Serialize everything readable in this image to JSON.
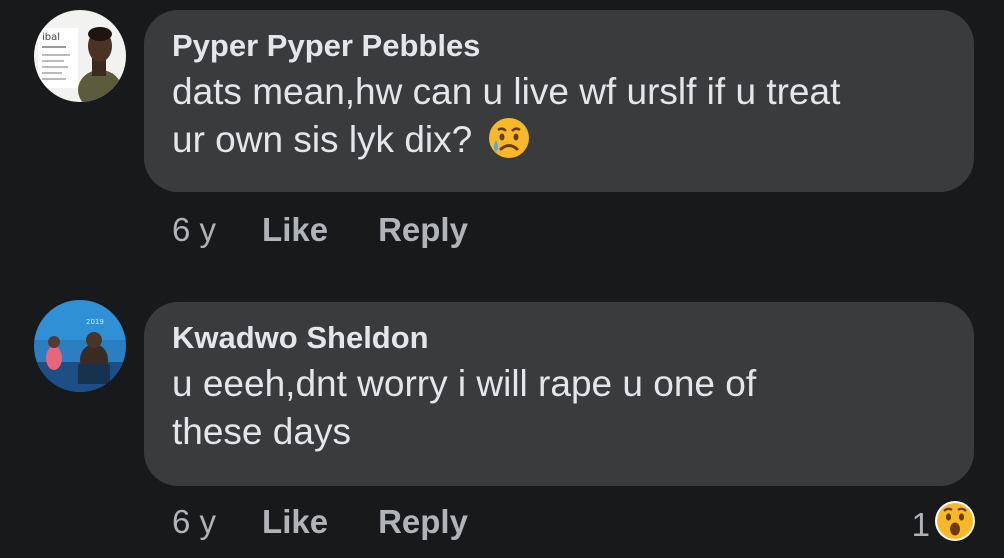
{
  "comments": [
    {
      "author": "Pyper Pyper Pebbles",
      "text_line1": "dats mean,hw can u live wf urslf if u treat",
      "text_line2": "ur own sis lyk dix?",
      "emoji": "crying-face",
      "age": "6 y",
      "like_label": "Like",
      "reply_label": "Reply",
      "reaction_count": ""
    },
    {
      "author": "Kwadwo Sheldon",
      "text_line1": "u eeeh,dnt worry i will rape u one of",
      "text_line2": "these days",
      "age": "6 y",
      "like_label": "Like",
      "reply_label": "Reply",
      "reaction_count": "1",
      "reaction_icon": "wow-reaction-icon"
    }
  ],
  "colors": {
    "background": "#18191a",
    "bubble": "#3a3b3c",
    "text_primary": "#e4e6eb",
    "text_secondary": "#b0b3b8"
  }
}
